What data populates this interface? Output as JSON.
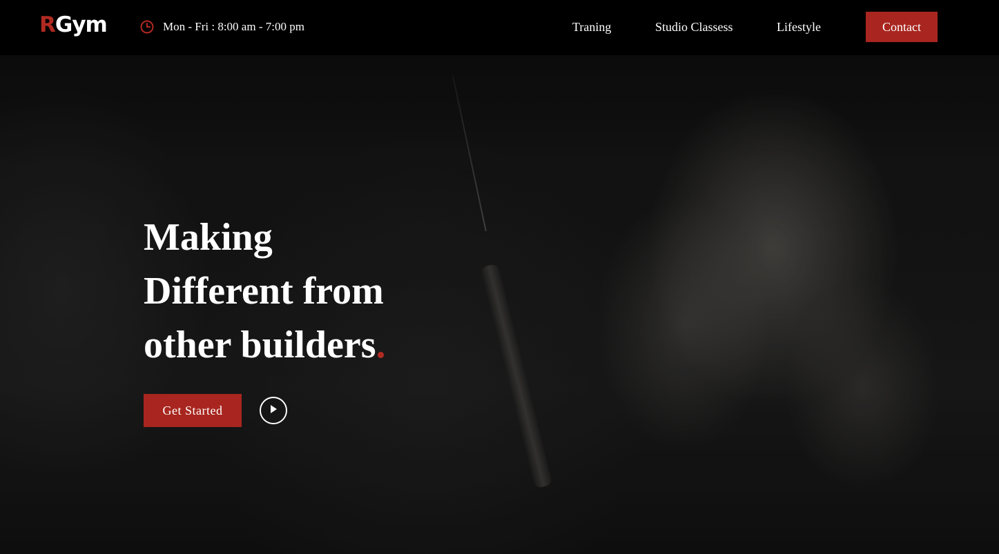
{
  "brand": {
    "logo_first": "R",
    "logo_rest": "Gym"
  },
  "header": {
    "hours": "Mon - Fri : 8:00 am - 7:00 pm",
    "nav": [
      "Traning",
      "Studio Classess",
      "Lifestyle"
    ],
    "contact_label": "Contact"
  },
  "hero": {
    "headline_line1": "Making",
    "headline_line2": "Different from",
    "headline_line3": "other builders",
    "headline_dot": ".",
    "cta_label": "Get Started",
    "play_icon": "play-icon"
  },
  "colors": {
    "accent": "#a8261f",
    "background": "#0c0c0c",
    "text": "#ffffff"
  },
  "icons": {
    "clock": "clock-icon",
    "play": "play-icon"
  }
}
